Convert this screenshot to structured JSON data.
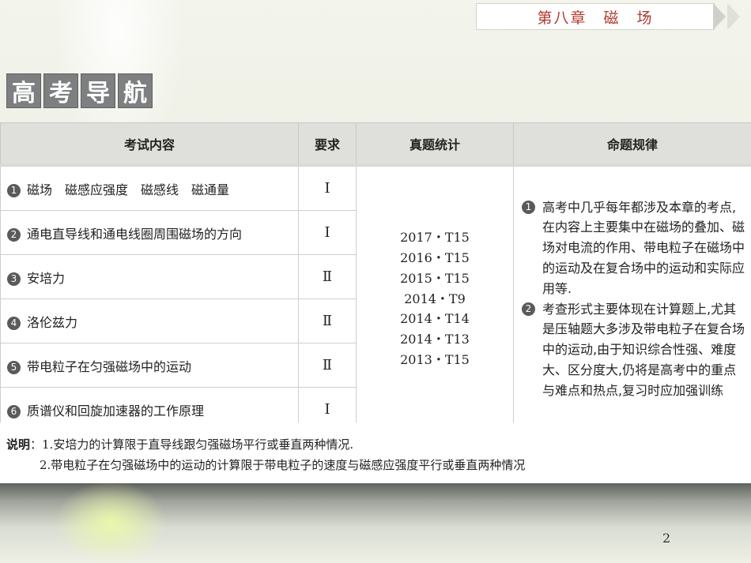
{
  "header": {
    "chapter": "第八章　磁　场"
  },
  "section_title": [
    "高",
    "考",
    "导",
    "航"
  ],
  "table": {
    "headers": [
      "考试内容",
      "要求",
      "真题统计",
      "命题规律"
    ],
    "rows": [
      {
        "num": "1",
        "content": "磁场　磁感应强度　磁感线　磁通量",
        "req": "Ⅰ"
      },
      {
        "num": "2",
        "content": "通电直导线和通电线圈周围磁场的方向",
        "req": "Ⅰ"
      },
      {
        "num": "3",
        "content": "安培力",
        "req": "Ⅱ"
      },
      {
        "num": "4",
        "content": "洛伦兹力",
        "req": "Ⅱ"
      },
      {
        "num": "5",
        "content": "带电粒子在匀强磁场中的运动",
        "req": "Ⅱ"
      },
      {
        "num": "6",
        "content": "质谱仪和回旋加速器的工作原理",
        "req": "Ⅰ"
      }
    ],
    "stats": [
      "2017・T15",
      "2016・T15",
      "2015・T15",
      "2014・T9",
      "2014・T14",
      "2014・T13",
      "2013・T15"
    ],
    "rules": [
      {
        "num": "1",
        "text": "高考中几乎每年都涉及本章的考点,在内容上主要集中在磁场的叠加、磁场对电流的作用、带电粒子在磁场中的运动及在复合场中的运动和实际应用等."
      },
      {
        "num": "2",
        "text": "考查形式主要体现在计算题上,尤其是压轴题大多涉及带电粒子在复合场中的运动,由于知识综合性强、难度大、区分度大,仍将是高考中的重点与难点和热点,复习时应加强训练"
      }
    ]
  },
  "notes": {
    "lead": "说明",
    "line1": "：1.安培力的计算限于直导线跟匀强磁场平行或垂直两种情况.",
    "line2": "2.带电粒子在匀强磁场中的运动的计算限于带电粒子的速度与磁感应强度平行或垂直两种情况"
  },
  "page_number": "2"
}
